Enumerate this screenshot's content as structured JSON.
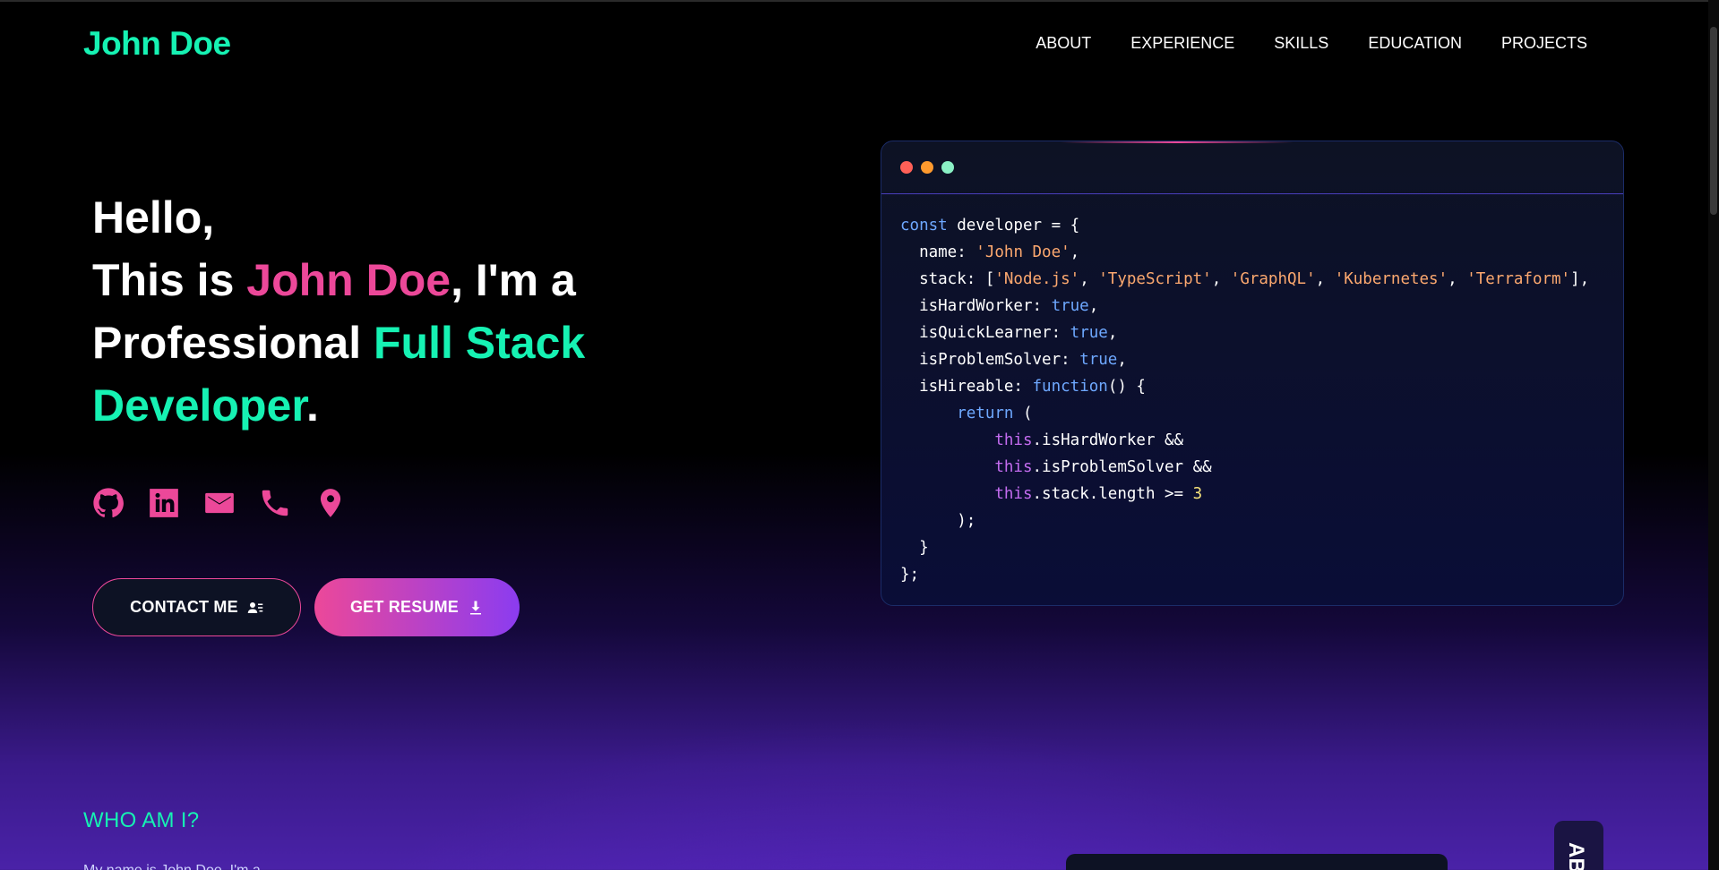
{
  "brand": "John Doe",
  "nav": {
    "items": [
      "ABOUT",
      "EXPERIENCE",
      "SKILLS",
      "EDUCATION",
      "PROJECTS"
    ]
  },
  "hero": {
    "line1": "Hello,",
    "line2_prefix": "This is ",
    "line2_name": "John Doe",
    "line2_suffix": ", I'm a",
    "line3_prefix": "Professional ",
    "line3_role": "Full Stack",
    "line4_role": "Developer",
    "line4_suffix": "."
  },
  "socials": [
    "github-icon",
    "linkedin-icon",
    "mail-icon",
    "phone-icon",
    "location-icon"
  ],
  "buttons": {
    "contact": "CONTACT ME",
    "resume": "GET RESUME"
  },
  "code": {
    "window_dots": [
      "#ff6057",
      "#ff9a2e",
      "#8af0c5"
    ],
    "lines": [
      [
        [
          "kw",
          "const "
        ],
        [
          "prop",
          "developer = {"
        ]
      ],
      [
        [
          "prop",
          "  name: "
        ],
        [
          "str",
          "'John Doe'"
        ],
        [
          "punc",
          ","
        ]
      ],
      [
        [
          "prop",
          "  stack: ["
        ],
        [
          "str",
          "'Node.js'"
        ],
        [
          "punc",
          ", "
        ],
        [
          "str",
          "'TypeScript'"
        ],
        [
          "punc",
          ", "
        ],
        [
          "str",
          "'GraphQL'"
        ],
        [
          "punc",
          ", "
        ],
        [
          "str",
          "'Kubernetes'"
        ],
        [
          "punc",
          ", "
        ],
        [
          "str",
          "'Terraform'"
        ],
        [
          "punc",
          "],"
        ]
      ],
      [
        [
          "prop",
          "  isHardWorker: "
        ],
        [
          "bool",
          "true"
        ],
        [
          "punc",
          ","
        ]
      ],
      [
        [
          "prop",
          "  isQuickLearner: "
        ],
        [
          "bool",
          "true"
        ],
        [
          "punc",
          ","
        ]
      ],
      [
        [
          "prop",
          "  isProblemSolver: "
        ],
        [
          "bool",
          "true"
        ],
        [
          "punc",
          ","
        ]
      ],
      [
        [
          "prop",
          "  isHireable: "
        ],
        [
          "kw",
          "function"
        ],
        [
          "punc",
          "() {"
        ]
      ],
      [
        [
          "kw",
          "      return "
        ],
        [
          "punc",
          "("
        ]
      ],
      [
        [
          "this",
          "          this"
        ],
        [
          "prop",
          ".isHardWorker &&"
        ]
      ],
      [
        [
          "this",
          "          this"
        ],
        [
          "prop",
          ".isProblemSolver &&"
        ]
      ],
      [
        [
          "this",
          "          this"
        ],
        [
          "prop",
          ".stack.length >= "
        ],
        [
          "num",
          "3"
        ]
      ],
      [
        [
          "punc",
          "      );"
        ]
      ],
      [
        [
          "punc",
          "  }"
        ]
      ],
      [
        [
          "punc",
          "};"
        ]
      ]
    ]
  },
  "about": {
    "heading": "WHO AM I?",
    "sub": "My name is John Doe. I'm a"
  },
  "side_tab": "AB",
  "colors": {
    "accent_green": "#16f2b3",
    "accent_pink": "#ec4899",
    "accent_purple": "#8b3cf0"
  }
}
